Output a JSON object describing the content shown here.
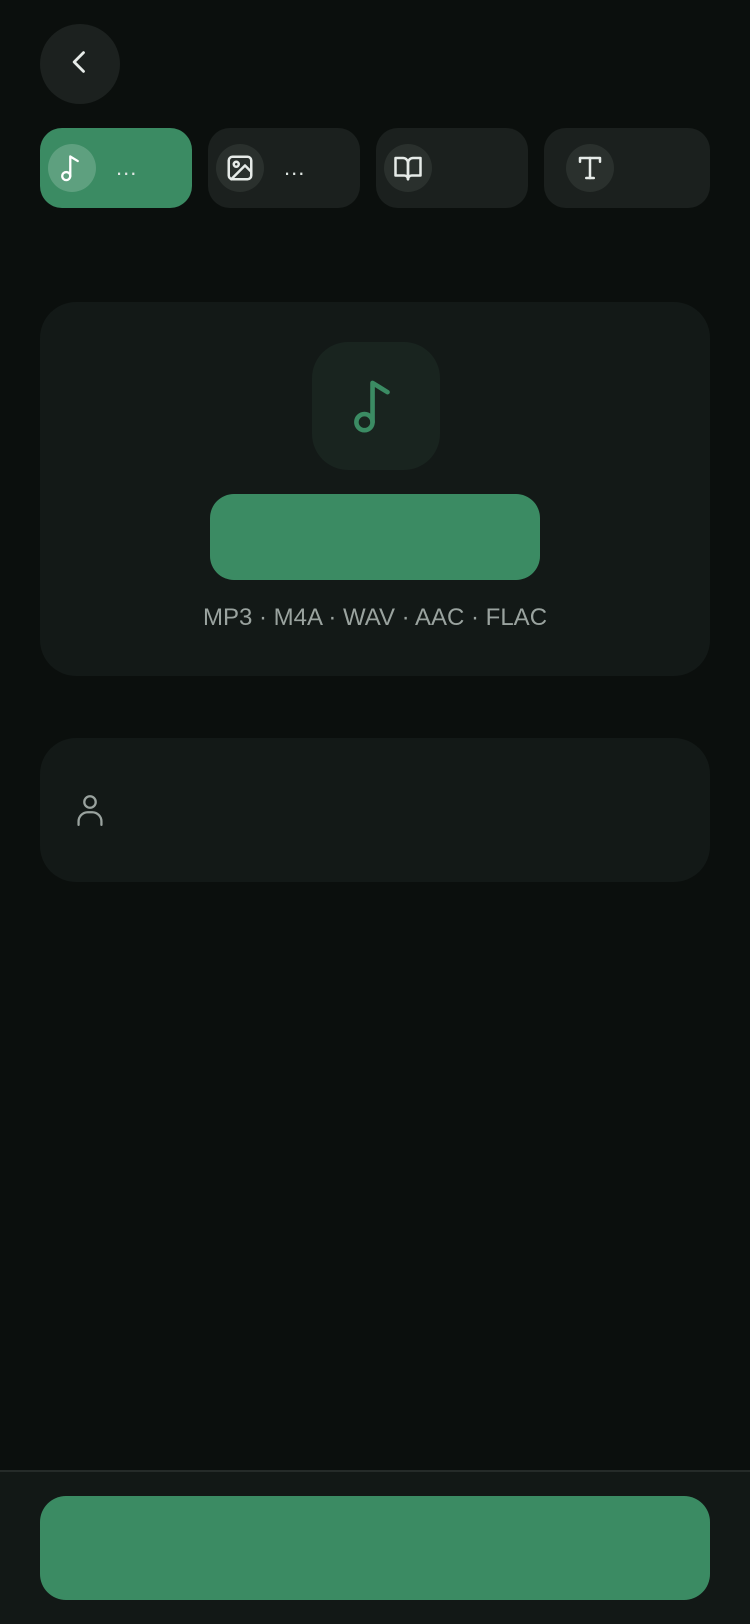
{
  "header": {
    "back_icon": "chevron-left-icon"
  },
  "tabs": [
    {
      "icon": "music-note-icon",
      "label": "...",
      "active": true
    },
    {
      "icon": "image-icon",
      "label": "...",
      "active": false
    },
    {
      "icon": "book-open-icon",
      "label": "",
      "active": false
    },
    {
      "icon": "text-type-icon",
      "label": "",
      "active": false
    }
  ],
  "upload": {
    "icon": "music-note-icon",
    "select_label": "",
    "formats": "MP3 · M4A · WAV · AAC · FLAC"
  },
  "artist": {
    "icon": "person-icon",
    "value": "",
    "placeholder": ""
  },
  "footer": {
    "primary_label": ""
  },
  "colors": {
    "accent": "#3b8b63",
    "background": "#0b0f0d",
    "card": "#131917"
  }
}
